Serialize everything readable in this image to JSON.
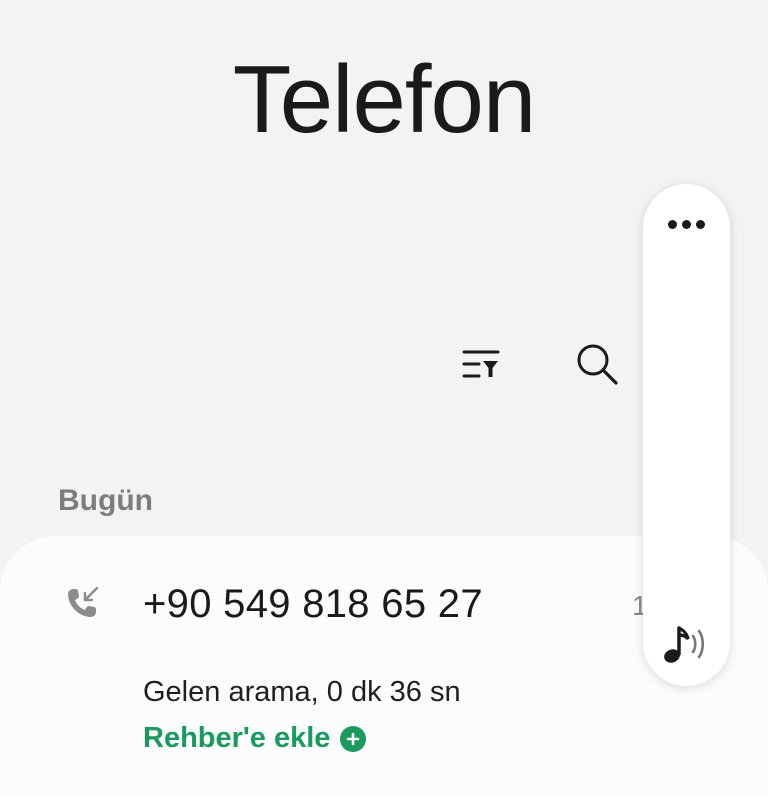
{
  "header": {
    "title": "Telefon"
  },
  "toolbar": {
    "filter_icon": "filter-list-icon",
    "search_icon": "search-icon"
  },
  "call_log": {
    "section_label": "Bugün",
    "entries": [
      {
        "icon": "incoming-call-icon",
        "number": "+90 549 818 65 27",
        "time_partial": "1",
        "detail": "Gelen arama, 0 dk 36 sn",
        "add_contact_label": "Rehber'e ekle"
      }
    ]
  },
  "side_panel": {
    "more_icon": "more-options-icon",
    "sound_icon": "music-sound-icon"
  },
  "colors": {
    "background": "#f3f3f3",
    "card": "#fcfcfc",
    "accent_green": "#1a9a5f",
    "section_label": "#7d7d7d"
  }
}
